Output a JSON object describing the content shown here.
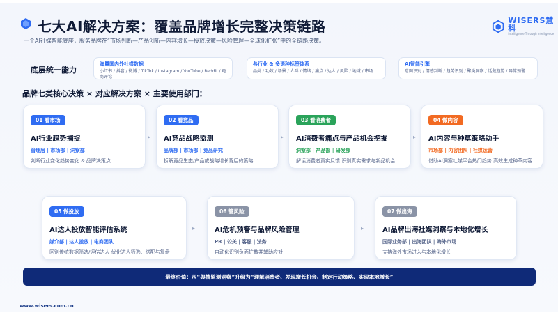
{
  "header": {
    "title": "七大AI解决方案：覆盖品牌增长完整决策链路",
    "subtitle": "一个AI社媒智能底座，服务品牌在“市场判断—产品创新—内容增长—投放决策—风险管理—全球化扩张”中的全链路决策。",
    "brand_name": "WISERS慧科",
    "brand_sub": "Intelligence Through Intelligence"
  },
  "capability": {
    "label": "底层统一能力",
    "boxes": [
      {
        "head": "海量国内外社媒数据",
        "body": "小红书 / 抖音 / 微博 / TikTok / Instagram / YouTube / Reddit / 电商评论"
      },
      {
        "head": "各行业 & 多语种标签体系",
        "body": "品类 / 功效 / 场景 / 人群 / 情绪 / 痛点 / 达人 / 风险 / 地域 / 市场"
      },
      {
        "head": "AI智能引擎",
        "body": "意图识别 / 情感判断 / 趋势识别 / 聚类洞察 / 话题趋势 / 异常预警"
      }
    ]
  },
  "section_title": "品牌七类核心决策 × 对应解决方案 × 主要使用部门：",
  "cards": [
    {
      "badge": "01 看市场",
      "title": "AI行业趋势捕捉",
      "depts": "管理层 | 市场部 | 洞察部",
      "desc": "判断行业变化趋势变化 & 品牌决策点",
      "color": "#2f6cf2"
    },
    {
      "badge": "02 看竞品",
      "title": "AI竞品战略监测",
      "depts": "品牌部 | 市场部 | 竞品研究",
      "desc": "拆解竞品生态/产品或战略增长背后的策略",
      "color": "#2f6cf2"
    },
    {
      "badge": "03 看消费者",
      "title": "AI消费者痛点与产品机会挖掘",
      "depts": "洞察部 | 产品部 | 研发部",
      "desc": "解读消费者真实反馈 识别真实需求与新品机会",
      "color": "#2aa35a"
    },
    {
      "badge": "04 做内容",
      "title": "AI内容与种草策略助手",
      "depts": "市场部 | 内容团队 | 社媒运营",
      "desc": "借助AI洞察社媒平台热门趋势 高效生成种草内容",
      "color": "#f26a22"
    },
    {
      "badge": "05 做投放",
      "title": "AI达人投放智能评估系统",
      "depts": "媒介部 | 达人投放 | 电商团队",
      "desc": "区别传统数据筛选/评估达人 优化达人筛选、搭配与复盘",
      "color": "#2f6cf2"
    },
    {
      "badge": "06 管风险",
      "title": "AI危机预警与品牌风险管理",
      "depts": "PR | 公关 | 客服 | 法务",
      "desc": "自动化识别负面扩散并辅助应对",
      "color": "#8a93a6"
    },
    {
      "badge": "07 做出海",
      "title": "AI品牌出海社媒洞察与本地化增长",
      "depts": "国际业务部 | 出海团队 | 海外市场",
      "desc": "支持海外市场进入与本地化增长",
      "color": "#8a93a6"
    }
  ],
  "value_bar": "最终价值：从“舆情监测洞察”升级为“理解消费者、发现增长机会、制定行动策略、实现本地增长”",
  "url": "www.wisers.com.cn"
}
